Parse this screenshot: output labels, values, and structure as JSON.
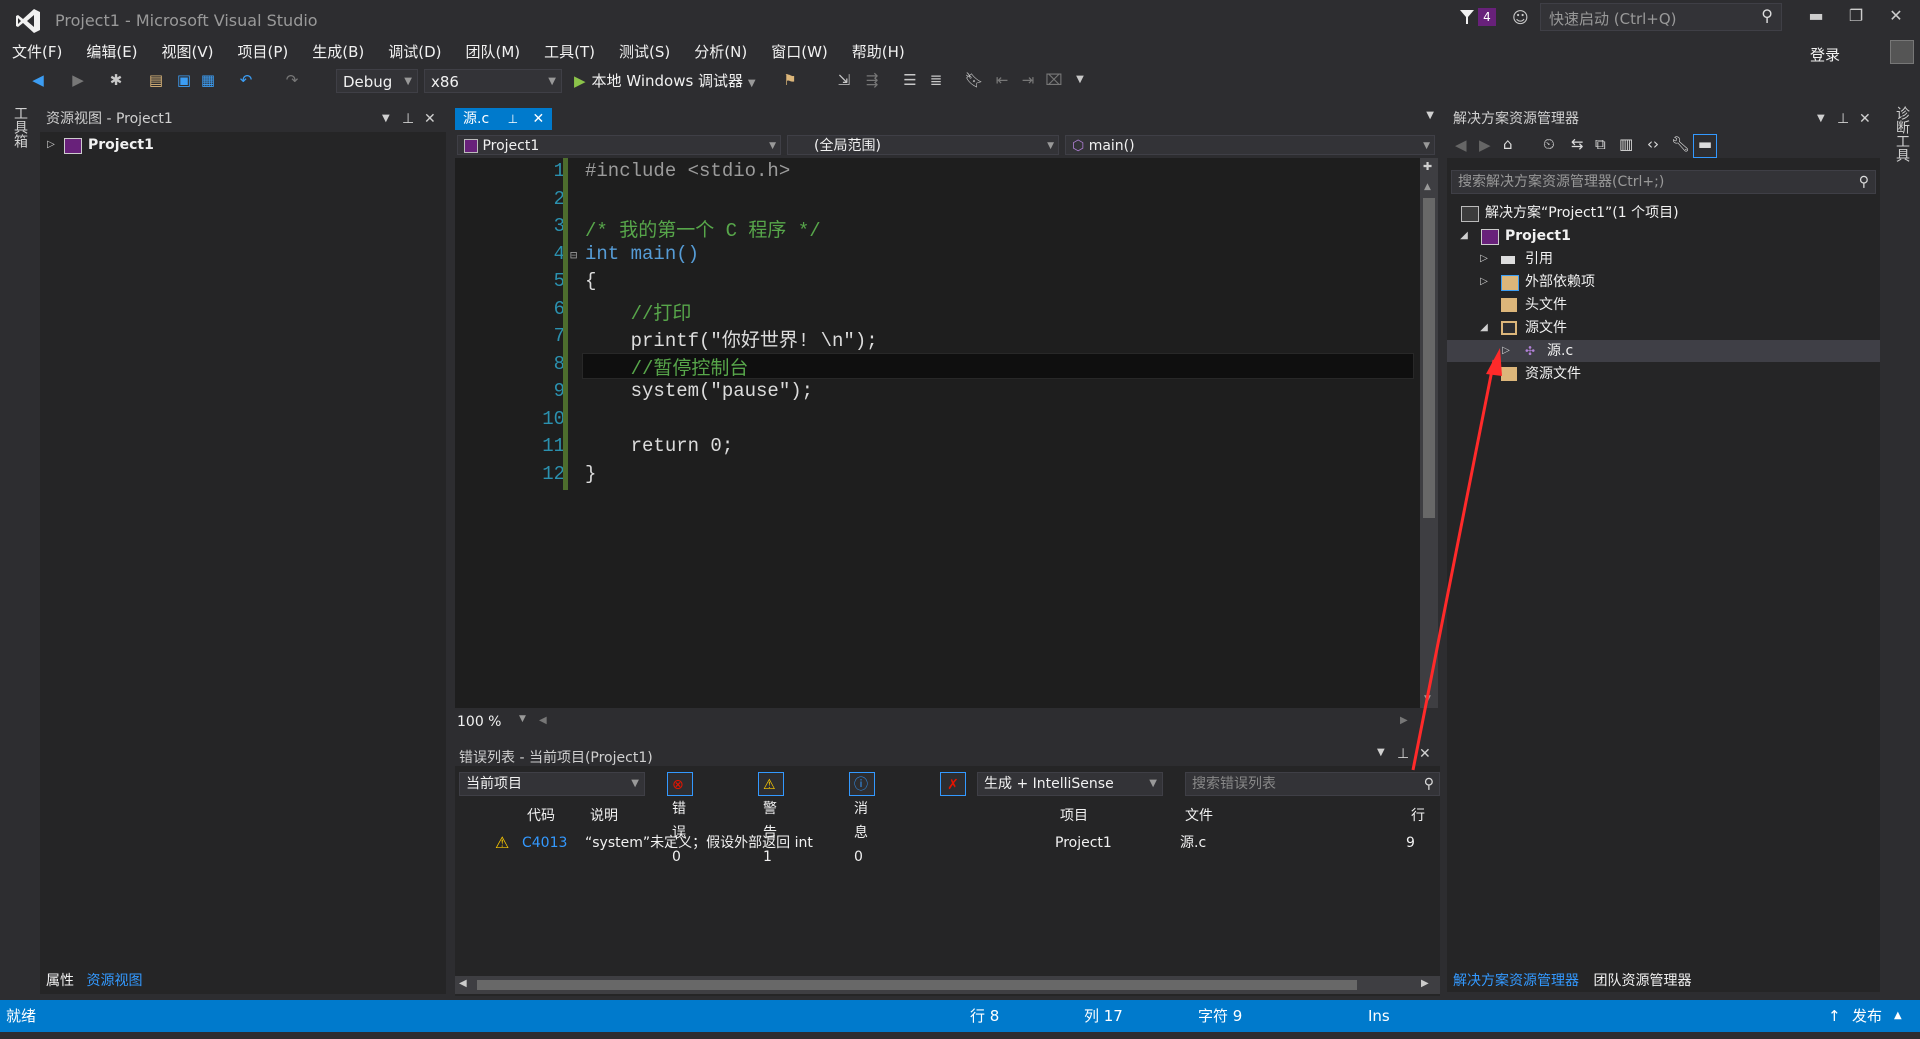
{
  "window": {
    "title": "Project1 - Microsoft Visual Studio",
    "notification_count": "4",
    "quick_launch_placeholder": "快速启动 (Ctrl+Q)",
    "login": "登录",
    "minimize": "▬",
    "restore": "❐",
    "close": "✕"
  },
  "menu": [
    "文件(F)",
    "编辑(E)",
    "视图(V)",
    "项目(P)",
    "生成(B)",
    "调试(D)",
    "团队(M)",
    "工具(T)",
    "测试(S)",
    "分析(N)",
    "窗口(W)",
    "帮助(H)"
  ],
  "toolbar": {
    "config": "Debug",
    "platform": "x86",
    "run_label": "本地 Windows 调试器"
  },
  "left_strip": {
    "toolbox": "工具箱"
  },
  "right_strip": {
    "diagnostics": "诊断工具"
  },
  "resource_view": {
    "title": "资源视图 - Project1",
    "root": "Project1",
    "tabs": [
      "属性",
      "资源视图"
    ]
  },
  "editor": {
    "tab_label": "源.c",
    "nav_project": "Project1",
    "nav_scope": "(全局范围)",
    "nav_member": "main()",
    "zoom": "100 %",
    "line_numbers": [
      "1",
      "2",
      "3",
      "4",
      "5",
      "6",
      "7",
      "8",
      "9",
      "10",
      "11",
      "12"
    ],
    "lines": [
      "#include <stdio.h>",
      "",
      "/* 我的第一个 C 程序 */",
      "int main()",
      "{",
      "    //打印",
      "    printf(\"你好世界! \\n\");",
      "    //暂停控制台",
      "    system(\"pause\");",
      "",
      "    return 0;",
      "}"
    ]
  },
  "error_list": {
    "title": "错误列表 - 当前项目(Project1)",
    "scope": "当前项目",
    "errors_chip": "错误 0",
    "warnings_chip": "警告 1",
    "messages_chip": "消息 0",
    "build_filter": "生成 + IntelliSense",
    "search_placeholder": "搜索错误列表",
    "columns": {
      "code": "代码",
      "desc": "说明",
      "project": "项目",
      "file": "文件",
      "line": "行"
    },
    "rows": [
      {
        "code": "C4013",
        "desc": "“system”未定义；假设外部返回 int",
        "project": "Project1",
        "file": "源.c",
        "line": "9"
      }
    ]
  },
  "solution_explorer": {
    "title": "解决方案资源管理器",
    "search_placeholder": "搜索解决方案资源管理器(Ctrl+;)",
    "tree": {
      "solution": "解决方案“Project1”(1 个项目)",
      "project": "Project1",
      "references": "引用",
      "external_deps": "外部依赖项",
      "headers": "头文件",
      "sources": "源文件",
      "source_file": "源.c",
      "resources": "资源文件"
    },
    "tabs": [
      "解决方案资源管理器",
      "团队资源管理器"
    ]
  },
  "status": {
    "ready": "就绪",
    "row": "行 8",
    "col": "列 17",
    "char": "字符 9",
    "ins": "Ins",
    "publish": "发布"
  },
  "colors": {
    "accent": "#007acc",
    "editor_bg": "#1e1e1e",
    "keyword": "#569cd6",
    "comment": "#57a64a",
    "string": "#d69d85",
    "annotation_arrow": "#ff2a2a"
  }
}
